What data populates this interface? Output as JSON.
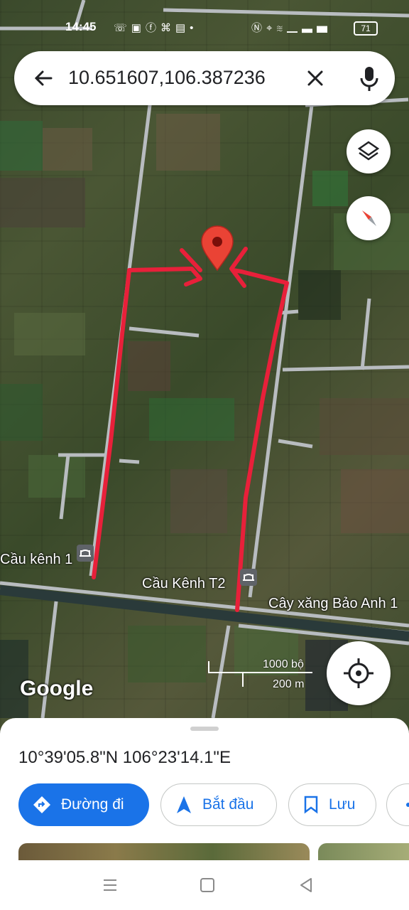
{
  "status_bar": {
    "time": "14:45",
    "left_icons": [
      "phone-icon",
      "messaging-icon",
      "facebook-icon",
      "game-icon",
      "shop-icon",
      "dot-icon"
    ],
    "right_icons": [
      "nfc-icon",
      "location-icon",
      "wifi-icon",
      "signal-icon",
      "signal-icon"
    ],
    "battery": "71"
  },
  "search": {
    "query": "10.651607,106.387236",
    "icons": [
      "back-arrow-icon",
      "close-icon",
      "mic-icon"
    ]
  },
  "map": {
    "map_icons": [
      "layers-icon",
      "compass-icon",
      "my-location-icon",
      "red-pin-icon"
    ],
    "labels": {
      "poi_1": "Cầu kênh 1",
      "poi_2": "Cầu Kênh T2",
      "poi_3": "Cây xăng Bảo Anh 1"
    },
    "scale": {
      "imperial": "1000 bộ",
      "metric": "200 m"
    },
    "logo": "Google",
    "annotation_color": "#e8203a",
    "pin_color": "#ea4335"
  },
  "sheet": {
    "coordinates": "10°39'05.8\"N 106°23'14.1\"E",
    "buttons": {
      "directions": "Đường đi",
      "start": "Bắt đầu",
      "save": "Lưu"
    },
    "accent_color": "#1a73e8"
  },
  "nav_bar": {
    "icons": [
      "menu-icon",
      "home-icon",
      "back-icon"
    ]
  }
}
